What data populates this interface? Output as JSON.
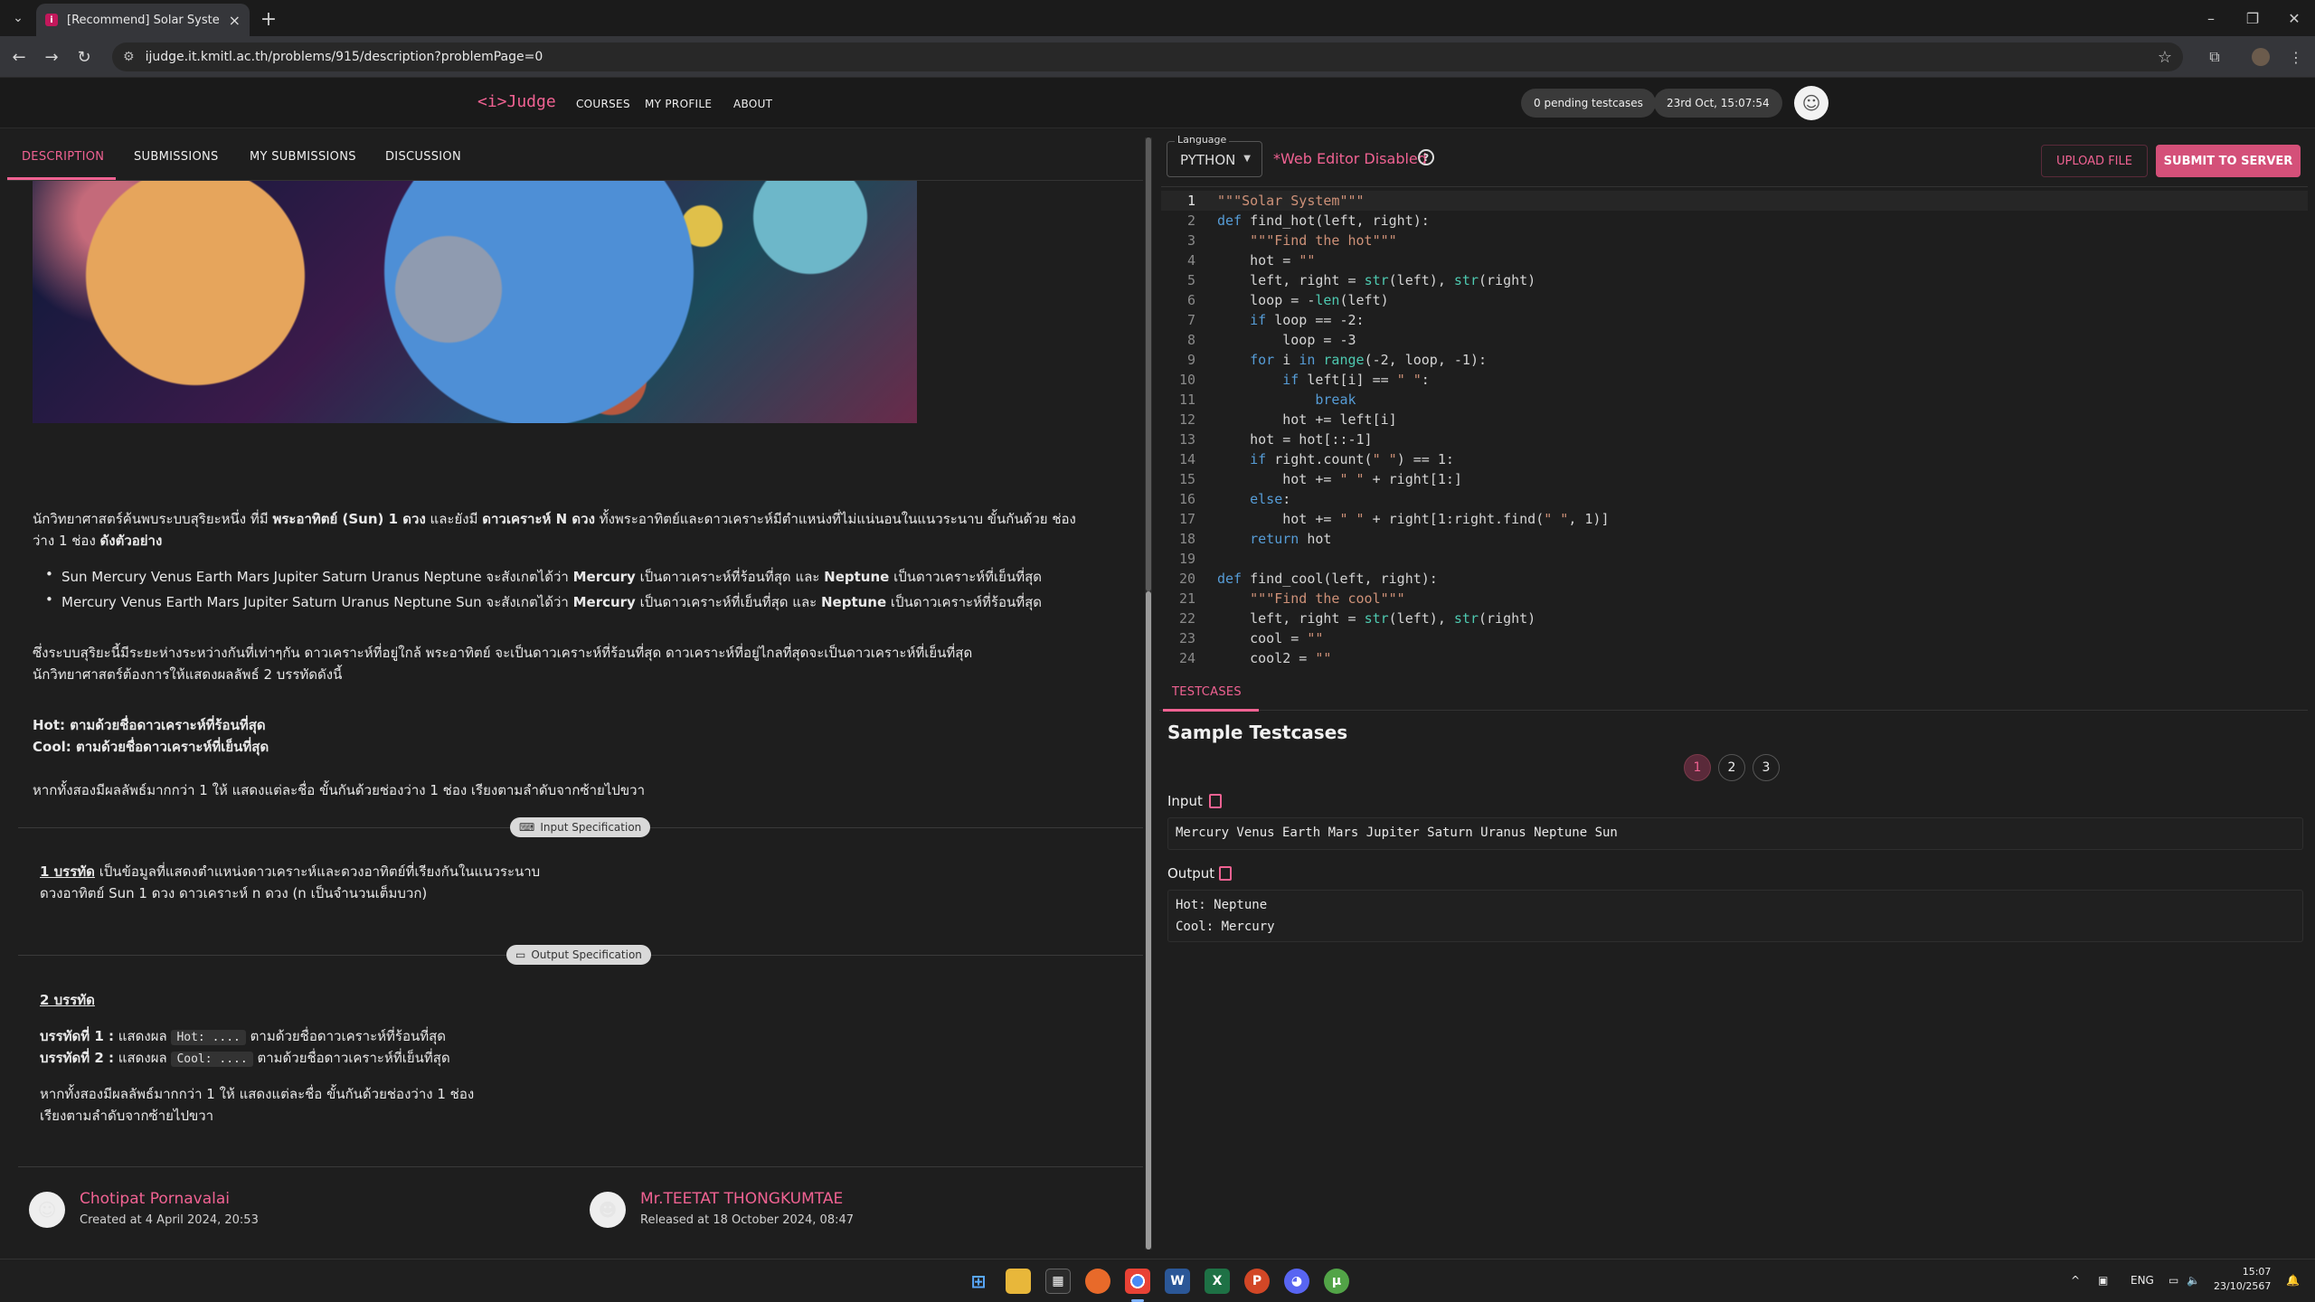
{
  "browser": {
    "tab_title": "[Recommend] Solar System - <",
    "url": "ijudge.it.kmitl.ac.th/problems/915/description?problemPage=0"
  },
  "header": {
    "logo": "<i>Judge",
    "nav": [
      "COURSES",
      "MY PROFILE",
      "ABOUT"
    ],
    "pending": "0 pending testcases",
    "datetime": "23rd Oct, 15:07:54"
  },
  "left": {
    "tabs": [
      "DESCRIPTION",
      "SUBMISSIONS",
      "MY SUBMISSIONS",
      "DISCUSSION"
    ],
    "p1_a": "นักวิทยาศาสตร์ค้นพบระบบสุริยะหนึ่ง ที่มี ",
    "p1_b": "พระอาทิตย์ (Sun) 1 ดวง",
    "p1_c": " และยังมี ",
    "p1_d": "ดาวเคราะห์ N ดวง",
    "p1_e": " ทั้งพระอาทิตย์และดาวเคราะห์มีตำแหน่งที่ไม่แน่นอนในแนวระนาบ ขั้นกันด้วย ช่อง",
    "p1_f": "ว่าง 1 ช่อง ",
    "p1_g": "ดังตัวอย่าง",
    "b1_a": "Sun Mercury Venus Earth Mars Jupiter Saturn Uranus Neptune จะสังเกตได้ว่า ",
    "b1_b": "Mercury",
    "b1_c": " เป็นดาวเคราะห์ที่ร้อนที่สุด และ ",
    "b1_d": "Neptune",
    "b1_e": " เป็นดาวเคราะห์ที่เย็นที่สุด",
    "b2_a": "Mercury Venus Earth Mars Jupiter Saturn Uranus Neptune Sun จะสังเกตได้ว่า ",
    "b2_b": "Mercury",
    "b2_c": " เป็นดาวเคราะห์ที่เย็นที่สุด และ ",
    "b2_d": "Neptune",
    "b2_e": " เป็นดาวเคราะห์ที่ร้อนที่สุด",
    "p2_1": "ซึ่งระบบสุริยะนี้มีระยะห่างระหว่างกันที่เท่าๆกัน ดาวเคราะห์ที่อยู่ใกล้ พระอาทิตย์ จะเป็นดาวเคราะห์ที่ร้อนที่สุด ดาวเคราะห์ที่อยู่ไกลที่สุดจะเป็นดาวเคราะห์ที่เย็นที่สุด",
    "p2_2": "นักวิทยาศาสตร์ต้องการให้แสดงผลลัพธ์ 2 บรรทัดดังนี้",
    "hot_line": "Hot: ตามด้วยชื่อดาวเคราะห์ที่ร้อนที่สุด",
    "cool_line": "Cool: ตามด้วยชื่อดาวเคราะห์ที่เย็นที่สุด",
    "p3": "หากทั้งสองมีผลลัพธ์มากกว่า 1 ให้ แสดงแต่ละชื่อ ขั้นกันด้วยช่องว่าง 1 ช่อง เรียงตามลำดับจากซ้ายไปขวา",
    "input_spec_label": "Input Specification",
    "in_1a": "1 บรรทัด",
    "in_1b": " เป็นข้อมูลที่แสดงตำแหน่งดาวเคราะห์และดวงอาทิตย์ที่เรียงกันในแนวระนาบ",
    "in_2": "ดวงอาทิตย์ Sun 1 ดวง ดาวเคราะห์ n ดวง (n เป็นจำนวนเต็มบวก)",
    "output_spec_label": "Output Specification",
    "out_title": "2 บรรทัด",
    "out_l1a": "บรรทัดที่ 1 :",
    "out_l1b": " แสดงผล ",
    "out_l1c": "Hot: ....",
    "out_l1d": " ตามด้วยชื่อดาวเคราะห์ที่ร้อนที่สุด",
    "out_l2a": "บรรทัดที่ 2 :",
    "out_l2b": " แสดงผล ",
    "out_l2c": "Cool: ....",
    "out_l2d": " ตามด้วยชื่อดาวเคราะห์ที่เย็นที่สุด",
    "out_p1": "หากทั้งสองมีผลลัพธ์มากกว่า 1 ให้ แสดงแต่ละชื่อ ขั้นกันด้วยช่องว่าง 1 ช่อง",
    "out_p2": "เรียงตามลำดับจากซ้ายไปขวา",
    "author1_name": "Chotipat Pornavalai",
    "author1_meta": "Created at 4 April 2024, 20:53",
    "author2_name": "Mr.TEETAT THONGKUMTAE",
    "author2_meta": "Released at 18 October 2024, 08:47"
  },
  "right": {
    "language_label": "Language",
    "language": "PYTHON",
    "disabled_note": "*Web Editor Disabled",
    "upload": "UPLOAD FILE",
    "submit": "SUBMIT TO SERVER",
    "code_lines": [
      "\"\"\"Solar System\"\"\"",
      "def find_hot(left, right):",
      "    \"\"\"Find the hot\"\"\"",
      "    hot = \"\"",
      "    left, right = str(left), str(right)",
      "    loop = -len(left)",
      "    if loop == -2:",
      "        loop = -3",
      "    for i in range(-2, loop, -1):",
      "        if left[i] == \" \":",
      "            break",
      "        hot += left[i]",
      "    hot = hot[::-1]",
      "    if right.count(\" \") == 1:",
      "        hot += \" \" + right[1:]",
      "    else:",
      "        hot += \" \" + right[1:right.find(\" \", 1)]",
      "    return hot",
      "",
      "def find_cool(left, right):",
      "    \"\"\"Find the cool\"\"\"",
      "    left, right = str(left), str(right)",
      "    cool = \"\"",
      "    cool2 = \"\""
    ],
    "testcases_tab": "TESTCASES",
    "sample_title": "Sample Testcases",
    "pages": [
      "1",
      "2",
      "3"
    ],
    "input_label": "Input",
    "input_value": "Mercury Venus Earth Mars Jupiter Saturn Uranus Neptune Sun",
    "output_label": "Output",
    "output_line1": "Hot: Neptune",
    "output_line2": "Cool: Mercury"
  },
  "taskbar": {
    "lang": "ENG",
    "time": "15:07",
    "date": "23/10/2567"
  }
}
